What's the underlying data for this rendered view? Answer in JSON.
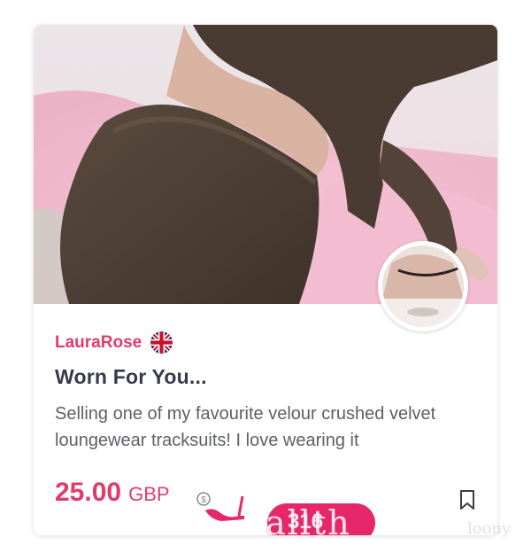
{
  "listing": {
    "seller": "LauraRose",
    "seller_country_flag": "uk-flag-icon",
    "title": "Worn For You...",
    "description": "Selling one of my favourite velour crushed velvet loungewear tracksuits! I love wearing it",
    "price_amount": "25.00",
    "price_currency": "GBP",
    "badge_count": "316",
    "watermark": "allth",
    "watermark_sub": "loony"
  },
  "colors": {
    "accent": "#e23b6a",
    "badge": "#e6276a",
    "title": "#363a4d",
    "body_text": "#5e6068"
  }
}
